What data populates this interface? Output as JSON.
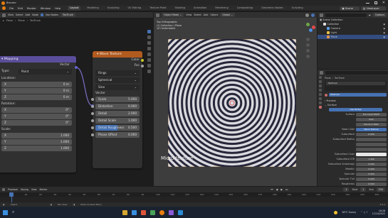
{
  "app": {
    "title": "Blender"
  },
  "menu": [
    "File",
    "Edit",
    "Render",
    "Window",
    "Help"
  ],
  "workspaces": [
    "Layout",
    "Modeling",
    "Sculpting",
    "UV Editing",
    "Texture Paint",
    "Shading",
    "Animation",
    "Rendering",
    "Compositing",
    "Geometry Nodes",
    "Scripting"
  ],
  "node_editor": {
    "breadcrumb": [
      "Plane",
      "Plane",
      "TexTrunk"
    ],
    "header_menu": [
      "View",
      "Select",
      "Add",
      "Node"
    ],
    "use_nodes_label": "Use Nodes",
    "slot_label": "TexTrunk",
    "mapping": {
      "title": "Mapping",
      "output_label": "Vector",
      "type_label": "Type:",
      "type_value": "Point",
      "location_label": "Location:",
      "rotation_label": "Rotation:",
      "scale_label": "Scale:",
      "location": [
        [
          "X",
          "0 m"
        ],
        [
          "Y",
          "0 m"
        ],
        [
          "Z",
          "0 m"
        ]
      ],
      "rotation": [
        [
          "X",
          "0°"
        ],
        [
          "Y",
          "0°"
        ],
        [
          "Z",
          "0°"
        ]
      ],
      "scale": [
        [
          "X",
          "1.000"
        ],
        [
          "Y",
          "1.000"
        ],
        [
          "Z",
          "1.000"
        ]
      ]
    },
    "wave": {
      "title": "Wave Texture",
      "outputs": [
        "Color",
        "Fac"
      ],
      "dropdowns": [
        "Rings",
        "Spherical",
        "Sine"
      ],
      "vector_label": "Vector",
      "inputs": [
        [
          "Scale",
          "5.000"
        ],
        [
          "Distortion",
          "0.000"
        ],
        [
          "Detail",
          "2.000"
        ],
        [
          "Detail Scale",
          "1.000"
        ],
        [
          "Detail Roughness",
          "0.500"
        ],
        [
          "Phase Offset",
          "0.000"
        ]
      ],
      "detail_roughness_fill": 0.5
    }
  },
  "viewport": {
    "mode": "Object Mode",
    "header_menu": [
      "View",
      "Select",
      "Add",
      "Object"
    ],
    "transform": "Global",
    "overlay_lines": [
      "Top Orthographic",
      "(1) Collection | Plane",
      "10 Centimeters"
    ],
    "label": "Micro texture",
    "axes": [
      "X",
      "Y",
      "Z"
    ],
    "ring_count": 14
  },
  "outliner": {
    "title": "Scene Collection",
    "items": [
      "Collection",
      "Camera",
      "Light",
      "Plane"
    ],
    "selected": "Plane",
    "options_label": "Options"
  },
  "scene_selector": {
    "scene": "Scene",
    "view_layer": "ViewLayer"
  },
  "properties": {
    "breadcrumb": [
      "Plane",
      "TexTrunk"
    ],
    "material_name": "TexTrunk",
    "sections": [
      "Preview",
      "Surface"
    ],
    "surface_label": "Use Nodes",
    "surface_shader": "Principled BSDF",
    "distribution": "GGX",
    "subsurface_method": "Random Walk",
    "base_color_label": "Base Color",
    "base_color_value": "Wave Texture",
    "rows": [
      [
        "Subsurface",
        "0.000"
      ],
      [
        "Subsurface Radius",
        ""
      ],
      [
        "",
        ""
      ],
      [
        "",
        ""
      ],
      [
        "Subsurface Color",
        ""
      ],
      [
        "Subsurface IOR",
        "1.400"
      ],
      [
        "Subsurface Anisotropy",
        "0.000"
      ],
      [
        "Metallic",
        "0.000"
      ],
      [
        "Specular",
        "0.500"
      ],
      [
        "Specular Tint",
        "0.000"
      ],
      [
        "Roughness",
        "0.500"
      ]
    ]
  },
  "timeline": {
    "menu": [
      "Playback",
      "Keying",
      "View",
      "Marker"
    ],
    "start_label": "Start",
    "start": "1",
    "end_label": "End",
    "end": "250",
    "current": "1",
    "ticks": [
      "0",
      "10",
      "20",
      "30",
      "40",
      "50",
      "60",
      "70",
      "80",
      "90",
      "100",
      "110",
      "120",
      "130",
      "140",
      "150",
      "160",
      "170",
      "180",
      "190",
      "200",
      "210",
      "220",
      "230",
      "240",
      "250"
    ]
  },
  "statusbar": {
    "left": "Select",
    "mid1": "Pan View",
    "mid2": "Node Context Menu",
    "version": "3.3.1"
  },
  "taskbar": {
    "weather": "16°C Sunny",
    "time": "16:28",
    "date": "17/10/2022"
  }
}
